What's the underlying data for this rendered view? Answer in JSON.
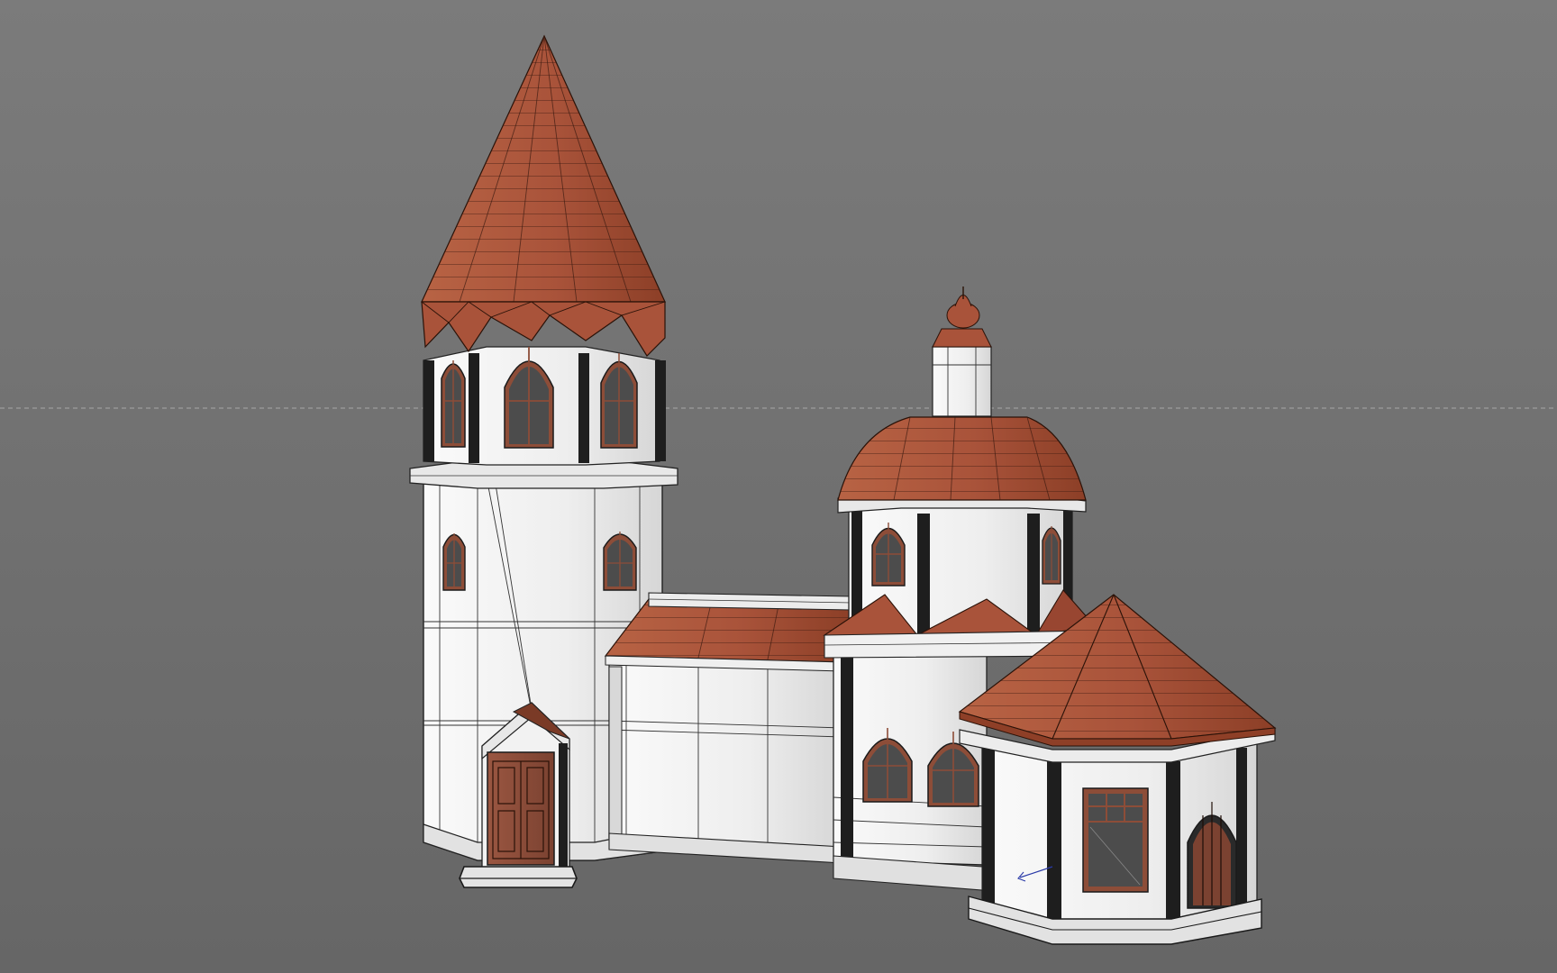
{
  "viewport": {
    "background_top": "#7a7a7a",
    "background_bottom": "#686868",
    "guide_line_color": "#a8a8a8"
  },
  "model": {
    "wall_color": "#f1f1f1",
    "wall_shade_color": "#d4d4d4",
    "roof_color": "#ad5537",
    "roof_shade_color": "#8e3f27",
    "column_color": "#1e1e1e",
    "edge_color": "#202020",
    "door_color": "#8d4d38",
    "window_glass_color": "#4c4c4c",
    "axis_gizmo_color": "#2a3aa8"
  }
}
